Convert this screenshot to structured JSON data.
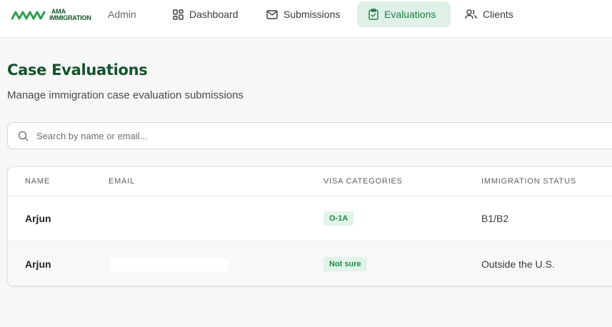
{
  "brand": {
    "logo_line1": "AMA",
    "logo_line2": "IMMIGRATION",
    "role": "Admin",
    "color": "#14532d"
  },
  "nav": {
    "items": [
      {
        "label": "Dashboard",
        "icon": "dashboard-icon"
      },
      {
        "label": "Submissions",
        "icon": "mail-icon"
      },
      {
        "label": "Evaluations",
        "icon": "clipboard-check-icon",
        "active": true
      },
      {
        "label": "Clients",
        "icon": "users-icon"
      }
    ],
    "active_bg": "#dff1e6",
    "active_color": "#1f7a44"
  },
  "page": {
    "title": "Case Evaluations",
    "subtitle": "Manage immigration case evaluation submissions"
  },
  "search": {
    "placeholder": "Search by name or email...",
    "value": "",
    "icon": "search-icon"
  },
  "table": {
    "columns": [
      "NAME",
      "EMAIL",
      "VISA CATEGORIES",
      "IMMIGRATION STATUS"
    ],
    "rows": [
      {
        "name": "Arjun",
        "email": "",
        "visa": "O-1A",
        "status": "B1/B2"
      },
      {
        "name": "Arjun",
        "email": "",
        "visa": "Not sure",
        "status": "Outside the U.S."
      }
    ],
    "badge_color": "#1f8a4c",
    "badge_bg": "#e2f3e8"
  }
}
